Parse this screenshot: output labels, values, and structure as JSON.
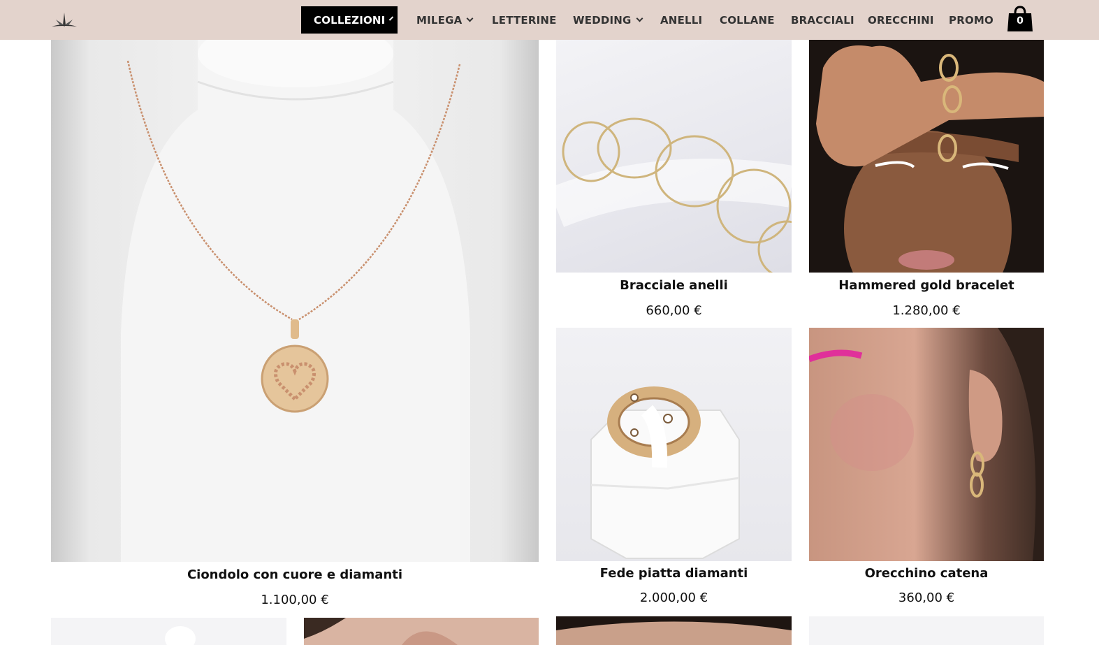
{
  "header": {
    "logo_icon": "star-burst-logo-icon",
    "nav": [
      {
        "label": "COLLEZIONI",
        "has_dropdown": true,
        "active": true
      },
      {
        "label": "MILEGA",
        "has_dropdown": true
      },
      {
        "label": "LETTERINE",
        "has_dropdown": false
      },
      {
        "label": "WEDDING",
        "has_dropdown": true
      },
      {
        "label": "ANELLI",
        "has_dropdown": false
      },
      {
        "label": "COLLANE",
        "has_dropdown": false
      },
      {
        "label": "BRACCIALI",
        "has_dropdown": false
      },
      {
        "label": "ORECCHINI",
        "has_dropdown": false
      },
      {
        "label": "PROMO",
        "has_dropdown": false
      }
    ],
    "cart": {
      "icon": "shopping-bag-icon",
      "count": "0"
    }
  },
  "products": [
    {
      "name": "Ciondolo con cuore e diamanti",
      "price": "1.100,00 €",
      "image": "heart-pendant-necklace-photo"
    },
    {
      "name": "Bracciale anelli",
      "price": "660,00 €",
      "image": "ring-link-bracelet-photo"
    },
    {
      "name": "Hammered gold bracelet",
      "price": "1.280,00 €",
      "image": "model-wrist-bracelet-photo"
    },
    {
      "name": "Fede piatta diamanti",
      "price": "2.000,00 €",
      "image": "diamond-band-ring-photo"
    },
    {
      "name": "Orecchino catena",
      "price": "360,00 €",
      "image": "chain-earring-model-photo"
    }
  ],
  "colors": {
    "header_bg": "#e3d3cc",
    "active_nav_bg": "#000000",
    "gold": "#d9b77a"
  }
}
